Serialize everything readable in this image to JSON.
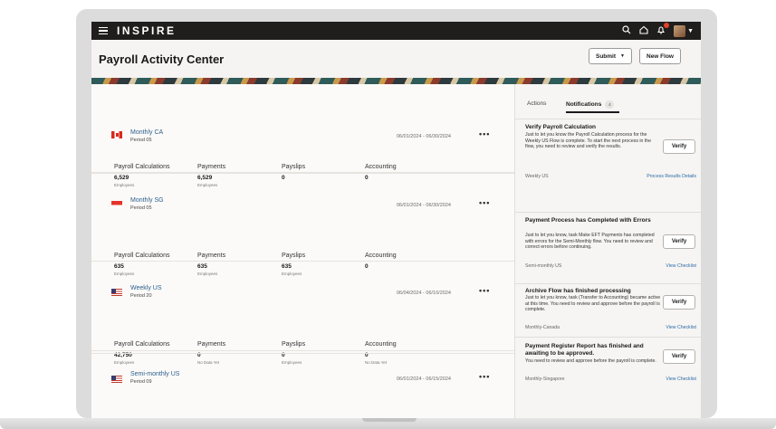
{
  "app": {
    "brand": "INSPIRE",
    "page_title": "Payroll Activity Center"
  },
  "topbar": {
    "icons": [
      "menu-icon",
      "search-icon",
      "home-icon",
      "bell-icon",
      "avatar",
      "chevron-down-icon"
    ]
  },
  "header": {
    "submit_label": "Submit",
    "new_flow_label": "New Flow"
  },
  "runs": [
    {
      "name": "Monthly CA",
      "period": "Period 05",
      "flag": "canada-flag-icon",
      "dates": "06/01/2024 - 06/30/2024",
      "metrics": [
        {
          "label": "Payroll Calculations",
          "value": "6,529",
          "sub": "Employees"
        },
        {
          "label": "Payments",
          "value": "6,529",
          "sub": "Employees"
        },
        {
          "label": "Payslips",
          "value": "0",
          "sub": ""
        },
        {
          "label": "Accounting",
          "value": "0",
          "sub": ""
        }
      ]
    },
    {
      "name": "Monthly SG",
      "period": "Period 05",
      "flag": "singapore-flag-icon",
      "dates": "06/01/2024 - 06/30/2024",
      "metrics": [
        {
          "label": "Payroll Calculations",
          "value": "635",
          "sub": "Employees"
        },
        {
          "label": "Payments",
          "value": "635",
          "sub": "Employees"
        },
        {
          "label": "Payslips",
          "value": "635",
          "sub": "Employees"
        },
        {
          "label": "Accounting",
          "value": "0",
          "sub": ""
        }
      ]
    },
    {
      "name": "Weekly US",
      "period": "Period 20",
      "flag": "us-flag-icon",
      "dates": "06/04/2024 - 06/10/2024",
      "metrics": [
        {
          "label": "Payroll Calculations",
          "value": "42,750",
          "sub": "Employees"
        },
        {
          "label": "Payments",
          "value": "0",
          "sub": "No Data Yet"
        },
        {
          "label": "Payslips",
          "value": "0",
          "sub": "Employees"
        },
        {
          "label": "Accounting",
          "value": "0",
          "sub": "No Data Yet"
        }
      ]
    },
    {
      "name": "Semi-monthly US",
      "period": "Period 09",
      "flag": "us-flag-icon",
      "dates": "06/01/2024 - 06/15/2024",
      "metrics": []
    }
  ],
  "sidebar": {
    "tabs": [
      {
        "label": "Actions"
      },
      {
        "label": "Notifications",
        "count": "4"
      }
    ],
    "notifications": [
      {
        "title": "Verify Payroll Calculation",
        "body": "Just to let you know the Payroll Calculation process for the Weekly US Flow is complete. To start the next process in the flow, you need to review and verify the results.",
        "source": "Weekly US",
        "link": "Process Results Details",
        "action": "Verify"
      },
      {
        "title": "Payment Process has Completed with Errors",
        "body": "Just to let you know, task Make EFT Payments has completed with errors for the Semi-Monthly flow. You need to review and correct errors before continuing.",
        "source": "Semi-monthly US",
        "link": "View Checklist",
        "action": "Verify"
      },
      {
        "title": "Archive Flow has finished processing",
        "body": "Just to let you know, task (Transfer to Accounting) became active at this time. You need to review and approve before the payroll is complete.",
        "source": "Monthly-Canada",
        "link": "View Checklist",
        "action": "Verify"
      },
      {
        "title": "Payment Register Report has finished and awaiting to be approved.",
        "body": "You need to review and approve before the payroll is complete.",
        "source": "Monthly-Singapore",
        "link": "View Checklist",
        "action": "Verify"
      }
    ]
  }
}
